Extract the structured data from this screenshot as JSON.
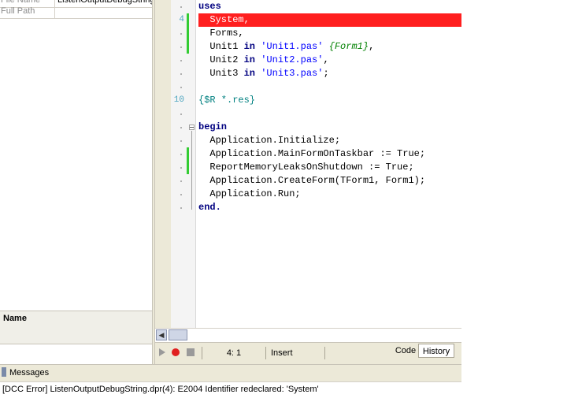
{
  "left_panel": {
    "rows": [
      {
        "key": "File Name",
        "value": "ListenOutputDebugString.dproj"
      },
      {
        "key": "Full Path",
        "value": ""
      }
    ],
    "name_header": "Name"
  },
  "editor": {
    "line_numbers": {
      "line4": "4",
      "line10": "10"
    },
    "lines": {
      "l1": "uses",
      "l2": "  System,",
      "l3": "  Forms,",
      "l4_a": "  Unit1 ",
      "l4_in": "in",
      "l4_str": "'Unit1.pas'",
      "l4_cmt": "{Form1}",
      "l4_end": ",",
      "l5_a": "  Unit2 ",
      "l5_in": "in",
      "l5_str": "'Unit2.pas'",
      "l5_end": ",",
      "l6_a": "  Unit3 ",
      "l6_in": "in",
      "l6_str": "'Unit3.pas'",
      "l6_end": ";",
      "l8": "{$R *.res}",
      "l10": "begin",
      "l11": "  Application.Initialize;",
      "l12": "  Application.MainFormOnTaskbar := True;",
      "l13": "  ReportMemoryLeaksOnShutdown := True;",
      "l14": "  Application.CreateForm(TForm1, Form1);",
      "l15": "  Application.Run;",
      "l16": "end."
    },
    "colors": {
      "error_line": "#ff1f1f",
      "change_bar": "#33cc33",
      "keyword": "#000080",
      "string": "#0000ff"
    }
  },
  "statusbar": {
    "cursor_position": "4:  1",
    "insert_mode": "Insert",
    "tabs": {
      "code": "Code",
      "history": "History"
    }
  },
  "messages": {
    "title": "Messages",
    "error": "[DCC Error] ListenOutputDebugString.dpr(4): E2004 Identifier redeclared: 'System'"
  }
}
